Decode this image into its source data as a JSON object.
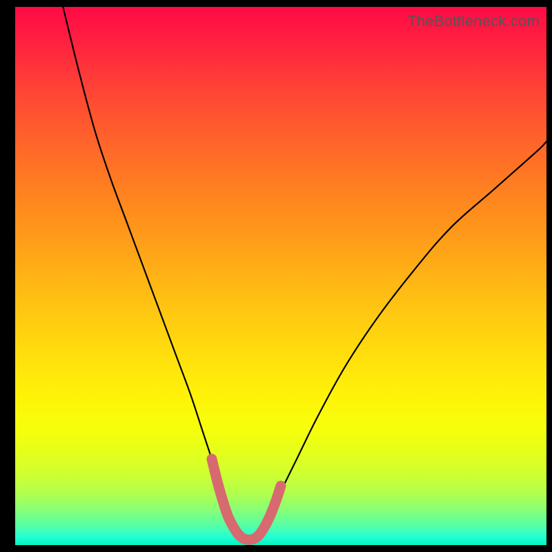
{
  "attribution": "TheBottleneck.com",
  "colors": {
    "page_bg": "#000000",
    "curve": "#000000",
    "highlight": "#d66a6f",
    "gradient_top": "#ff0a46",
    "gradient_bottom": "#00f4c0"
  },
  "chart_data": {
    "type": "line",
    "title": "",
    "xlabel": "",
    "ylabel": "",
    "xlim": [
      0,
      100
    ],
    "ylim": [
      0,
      100
    ],
    "grid": false,
    "series": [
      {
        "name": "bottleneck-curve",
        "x": [
          9,
          12,
          15,
          18,
          21,
          24,
          27,
          30,
          33,
          35,
          37,
          39,
          40,
          41,
          42,
          43,
          44,
          45,
          46,
          48,
          50,
          53,
          57,
          62,
          68,
          75,
          82,
          90,
          98,
          100
        ],
        "y": [
          100,
          88,
          77,
          68,
          60,
          52,
          44,
          36,
          28,
          22,
          16,
          10,
          6,
          3,
          1.5,
          1,
          1,
          1.5,
          3,
          6,
          10,
          16,
          24,
          33,
          42,
          51,
          59,
          66,
          73,
          75
        ]
      },
      {
        "name": "optimal-range-highlight",
        "x": [
          37,
          38,
          39,
          40,
          41,
          42,
          43,
          44,
          45,
          46,
          47,
          48,
          49,
          50
        ],
        "y": [
          16,
          12,
          8.5,
          5.5,
          3.5,
          2,
          1.2,
          1,
          1.2,
          2,
          3.5,
          5.5,
          8,
          11
        ]
      }
    ]
  }
}
